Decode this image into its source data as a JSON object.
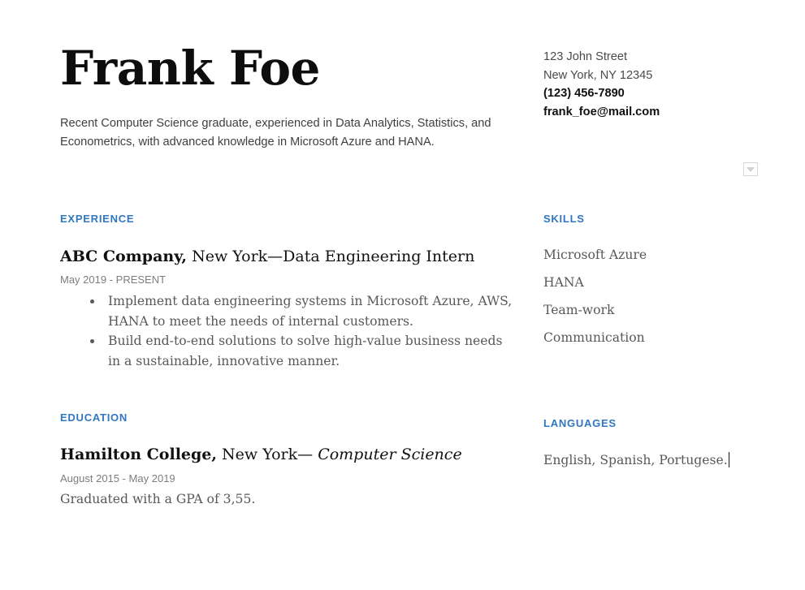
{
  "theme": {
    "accent_blue": "#3077c0",
    "body_gray": "#56585a",
    "date_gray": "#7d7d7d",
    "heading_black": "#111111",
    "page_background": "#ffffff"
  },
  "header": {
    "name": "Frank Foe",
    "summary": "Recent Computer Science graduate, experienced in Data Analytics, Statistics, and Econometrics, with advanced knowledge in Microsoft Azure and HANA."
  },
  "contact": {
    "street": "123 John Street",
    "city_state_zip": "New York, NY 12345",
    "phone": "(123) 456-7890",
    "email": "frank_foe@mail.com"
  },
  "widgets": {
    "dropdown_icon": "chevron-down-icon"
  },
  "sections": {
    "experience": {
      "heading": "EXPERIENCE",
      "entry": {
        "organization": "ABC Company,",
        "location_and_role": " New York—Data Engineering Intern",
        "date_range": "May 2019 - PRESENT",
        "bullets": [
          "Implement data engineering systems in Microsoft Azure, AWS, HANA to meet the needs of internal customers.",
          "Build end-to-end solutions to solve high-value business needs in a sustainable, innovative manner."
        ]
      }
    },
    "education": {
      "heading": "EDUCATION",
      "entry": {
        "organization": "Hamilton College,",
        "location": " New York— ",
        "field": "Computer Science",
        "date_range": "August 2015 - May 2019",
        "note": "Graduated with a GPA of 3,55."
      }
    },
    "skills": {
      "heading": "SKILLS",
      "items": [
        "Microsoft Azure",
        "HANA",
        "Team-work",
        "Communication"
      ]
    },
    "languages": {
      "heading": "LANGUAGES",
      "value": "English, Spanish, Portugese."
    }
  }
}
